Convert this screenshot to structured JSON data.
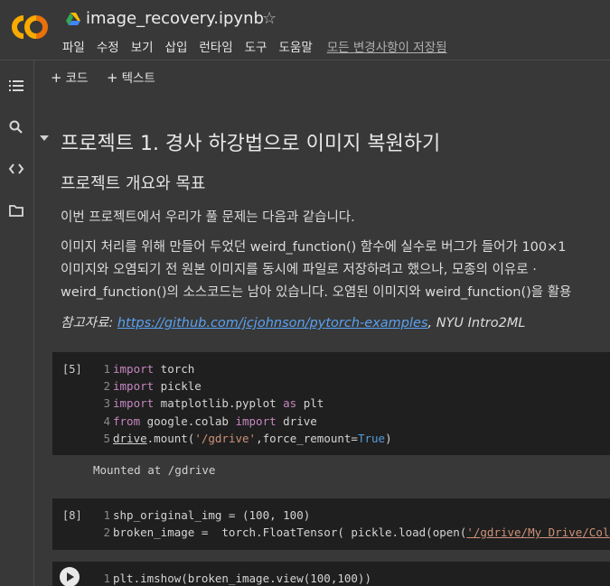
{
  "app": {
    "title": "image_recovery.ipynb",
    "logo_text": "CO",
    "menu": [
      "파일",
      "수정",
      "보기",
      "삽입",
      "런타임",
      "도구",
      "도움말"
    ],
    "saved_status": "모든 변경사항이 저장됨"
  },
  "toolbar": {
    "add_code": "코드",
    "add_text": "텍스트"
  },
  "sidebar": {
    "icons": [
      "toc-icon",
      "search-icon",
      "code-snippets-icon",
      "files-icon"
    ]
  },
  "notebook": {
    "heading1": "프로젝트 1. 경사 하강법으로 이미지 복원하기",
    "heading2": "프로젝트 개요와 목표",
    "paragraphs": [
      "이번 프로젝트에서 우리가 풀 문제는 다음과 같습니다.",
      "이미지 처리를 위해 만들어 두었던 weird_function() 함수에 실수로 버그가 들어가 100×1",
      "이미지와 오염되기 전 원본 이미지를 동시에 파일로 저장하려고 했으나, 모종의 이유로 ·",
      "weird_function()의 소스코드는 남아 있습니다. 오염된 이미지와 weird_function()을 활용"
    ],
    "reference": {
      "prefix": "참고자료: ",
      "link": "https://github.com/jcjohnson/pytorch-examples",
      "suffix": ", NYU Intro2ML"
    },
    "cells": [
      {
        "exec_count": "[5]",
        "lines": [
          "import torch",
          "import pickle",
          "import matplotlib.pyplot as plt",
          "from google.colab import drive",
          "drive.mount('/gdrive',force_remount=True)"
        ],
        "output": "Mounted at /gdrive"
      },
      {
        "exec_count": "[8]",
        "lines": [
          "shp_original_img = (100, 100)",
          "broken_image =  torch.FloatTensor( pickle.load(open('/gdrive/My Drive/Colab Note"
        ]
      },
      {
        "exec_count": "",
        "lines": [
          "plt.imshow(broken_image.view(100,100))"
        ]
      }
    ]
  },
  "colors": {
    "background": "#383838",
    "code_cell": "#1f1f1f",
    "link": "#5aa1f0",
    "keyword": "#c586c0",
    "string": "#ce9178",
    "logo_orange": "#f9ab00"
  }
}
